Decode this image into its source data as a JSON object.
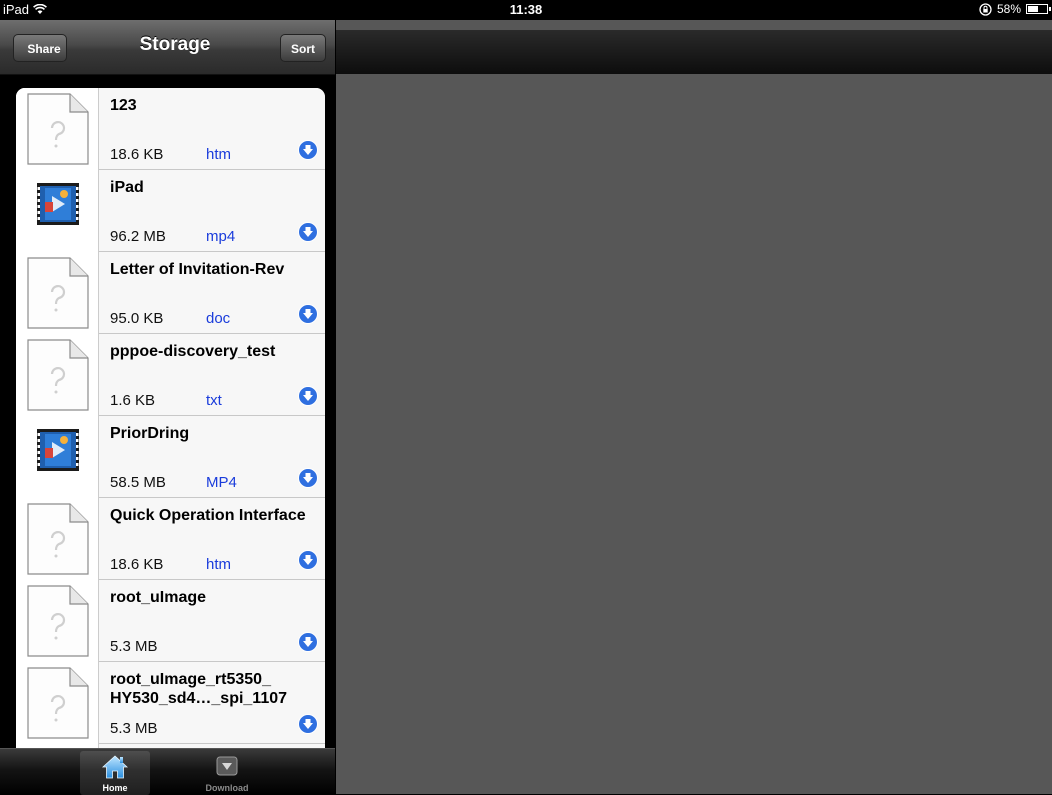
{
  "status_bar": {
    "device": "iPad",
    "time": "11:38",
    "battery_text": "58%",
    "battery_level": 0.58
  },
  "nav": {
    "title": "Storage",
    "share_label": "Share",
    "sort_label": "Sort"
  },
  "files": [
    {
      "name": "123",
      "size": "18.6 KB",
      "type": "htm",
      "icon": "document-unknown-icon"
    },
    {
      "name": "iPad",
      "size": "96.2 MB",
      "type": "mp4",
      "icon": "video-file-icon"
    },
    {
      "name": "Letter of Invitation-Rev",
      "size": "95.0 KB",
      "type": "doc",
      "icon": "document-unknown-icon"
    },
    {
      "name": "pppoe-discovery_test",
      "size": "1.6 KB",
      "type": "txt",
      "icon": "document-unknown-icon"
    },
    {
      "name": "PriorDring",
      "size": "58.5 MB",
      "type": "MP4",
      "icon": "video-file-icon"
    },
    {
      "name": "Quick Operation Interface",
      "size": "18.6 KB",
      "type": "htm",
      "icon": "document-unknown-icon"
    },
    {
      "name": "root_uImage",
      "size": "5.3 MB",
      "type": "",
      "icon": "document-unknown-icon"
    },
    {
      "name": "root_uImage_rt5350_ HY530_sd4…_spi_1107",
      "size": "5.3 MB",
      "type": "",
      "icon": "document-unknown-icon"
    }
  ],
  "tabs": [
    {
      "label": "Home",
      "icon": "home-icon",
      "selected": true
    },
    {
      "label": "Download",
      "icon": "download-icon",
      "selected": false
    }
  ],
  "colors": {
    "file_type": "#1a3cdb",
    "detail_background": "#575757",
    "download_button": "#2f6fe0"
  }
}
